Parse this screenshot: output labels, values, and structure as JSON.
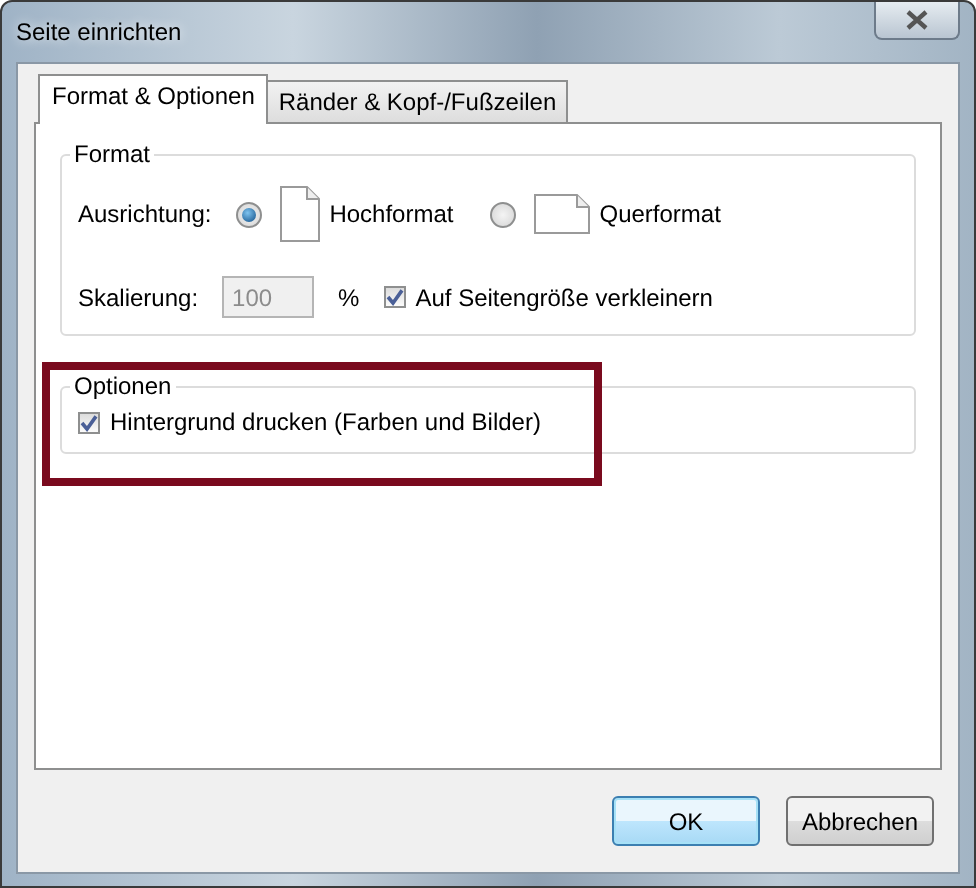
{
  "window": {
    "title": "Seite einrichten"
  },
  "tabs": [
    {
      "label": "Format & Optionen",
      "selected": true
    },
    {
      "label": "Ränder & Kopf-/Fußzeilen",
      "selected": false
    }
  ],
  "format_group": {
    "title": "Format",
    "orientation_label": "Ausrichtung:",
    "orientations": [
      {
        "label": "Hochformat",
        "kind": "portrait",
        "selected": true
      },
      {
        "label": "Querformat",
        "kind": "landscape",
        "selected": false
      }
    ],
    "scale_label": "Skalierung:",
    "scale_value": "100",
    "scale_disabled": true,
    "percent": "%",
    "shrink": {
      "label": "Auf Seitengröße verkleinern",
      "checked": true
    }
  },
  "options_group": {
    "title": "Optionen",
    "highlighted": true,
    "background": {
      "label": "Hintergrund drucken (Farben und Bilder)",
      "checked": true
    }
  },
  "buttons": [
    {
      "label": "OK",
      "default": true
    },
    {
      "label": "Abbrechen",
      "default": false
    }
  ]
}
